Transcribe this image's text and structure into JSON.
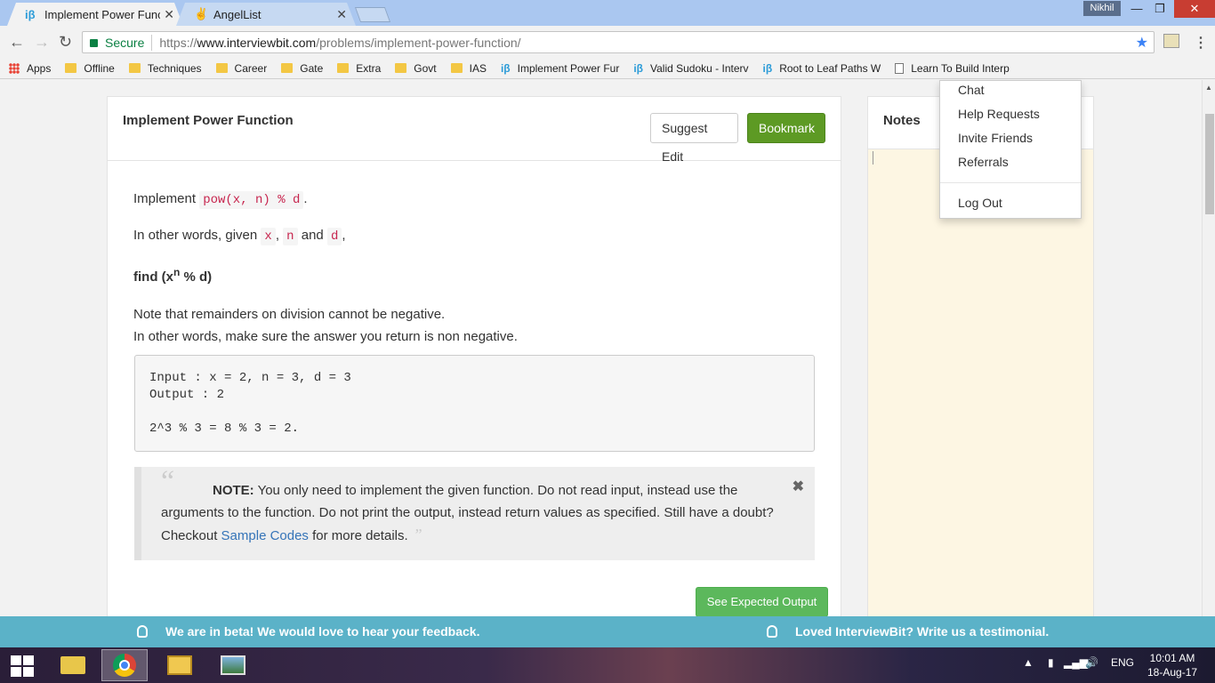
{
  "browser": {
    "tabs": [
      {
        "favicon": "iβ",
        "title": "Implement Power Functio"
      },
      {
        "favicon": "✌",
        "title": "AngelList"
      }
    ],
    "user": "Nikhil",
    "secure_label": "Secure",
    "url_scheme": "https://",
    "url_host": "www.interviewbit.com",
    "url_path": "/problems/implement-power-function/",
    "bookmarks": [
      {
        "icon": "apps-icon",
        "label": "Apps"
      },
      {
        "icon": "folder-icon",
        "label": "Offline"
      },
      {
        "icon": "folder-icon",
        "label": "Techniques"
      },
      {
        "icon": "folder-icon",
        "label": "Career"
      },
      {
        "icon": "folder-icon",
        "label": "Gate"
      },
      {
        "icon": "folder-icon",
        "label": "Extra"
      },
      {
        "icon": "folder-icon",
        "label": "Govt"
      },
      {
        "icon": "folder-icon",
        "label": "IAS"
      },
      {
        "icon": "interviewbit-icon",
        "label": "Implement Power Fur"
      },
      {
        "icon": "interviewbit-icon",
        "label": "Valid Sudoku - Interv"
      },
      {
        "icon": "interviewbit-icon",
        "label": "Root to Leaf Paths W"
      },
      {
        "icon": "document-icon",
        "label": "Learn To Build Interp"
      }
    ]
  },
  "problem": {
    "title": "Implement Power Function",
    "suggest_label": "Suggest Edit",
    "bookmark_label": "Bookmark",
    "intro_text": "Implement",
    "intro_code": "pow(x, n) % d",
    "given_text": "In other words, given",
    "code_x": "x",
    "code_n": "n",
    "and_text": "and",
    "code_d": "d",
    "find_prefix": "find (x",
    "find_sup": "n",
    "find_suffix": " % d)",
    "note_line1": "Note that remainders on division cannot be negative.",
    "note_line2": "In other words, make sure the answer you return is non negative.",
    "example": "Input : x = 2, n = 3, d = 3\nOutput : 2\n\n2^3 % 3 = 8 % 3 = 2.",
    "note_label": "NOTE:",
    "note_body": " You only need to implement the given function. Do not read input, instead use the arguments to the function. Do not print the output, instead return values as specified. Still have a doubt? Checkout ",
    "note_link": "Sample Codes",
    "note_tail": " for more details.",
    "expected_output_label": "See Expected Output"
  },
  "notes": {
    "title": "Notes"
  },
  "user_menu": {
    "items": [
      "Chat",
      "Help Requests",
      "Invite Friends",
      "Referrals"
    ],
    "logout": "Log Out"
  },
  "beta_bar": {
    "left": "We are in beta! We would love to hear your feedback.",
    "right": "Loved InterviewBit? Write us a testimonial."
  },
  "taskbar": {
    "lang": "ENG",
    "time": "10:01 AM",
    "date": "18-Aug-17"
  }
}
